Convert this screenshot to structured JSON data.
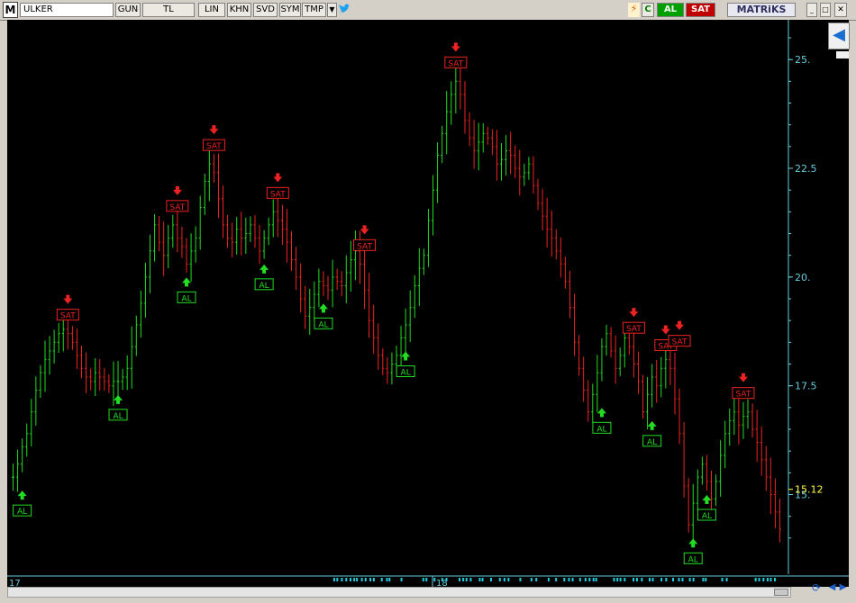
{
  "toolbar": {
    "logo": "M",
    "symbol": "ULKER",
    "period": "GUN",
    "currency": "TL",
    "scale": "LIN",
    "khn": "KHN",
    "svd": "SVD",
    "sym": "SYM",
    "tmp": "TMP",
    "dropdown": "▼",
    "twitter_icon": "twitter-icon",
    "flash_icon": "⚡",
    "refresh": "C",
    "buy_label": "AL",
    "sell_label": "SAT",
    "brand": "MATRiKS",
    "minimize": "_",
    "maximize": "□",
    "close": "✕"
  },
  "colors": {
    "background": "#000000",
    "up": "#22dd22",
    "down": "#ee2222",
    "axis": "#66ccdd",
    "last_price": "#ffff44",
    "buy": "#22dd22",
    "sell": "#ee2222"
  },
  "side_button_icon": "arrow-left-icon",
  "bottom_bar": {
    "month_left": "17",
    "month_mid": "18"
  },
  "chart_data": {
    "type": "line",
    "title": "",
    "xlabel": "",
    "ylabel": "",
    "ylim": [
      13.5,
      25.5
    ],
    "ytick_labels": [
      "25.",
      "22.5",
      "20.",
      "17.5",
      "15."
    ],
    "yticks": [
      25,
      22.5,
      20,
      17.5,
      15
    ],
    "last_price": 15.12,
    "last_price_label": "15.12",
    "x_labels": [
      "17",
      "18"
    ],
    "grid": false,
    "close": [
      15.4,
      15.7,
      16.1,
      16.4,
      16.9,
      17.4,
      17.8,
      18.1,
      18.3,
      18.5,
      18.7,
      18.8,
      18.7,
      18.5,
      18.2,
      17.9,
      17.7,
      17.6,
      17.8,
      17.7,
      17.6,
      17.5,
      17.6,
      17.6,
      17.7,
      17.9,
      18.4,
      18.9,
      19.4,
      20.0,
      20.6,
      21.2,
      20.8,
      20.5,
      20.9,
      21.2,
      20.9,
      20.7,
      20.3,
      20.6,
      20.9,
      21.6,
      22.2,
      22.6,
      22.4,
      21.8,
      21.2,
      20.9,
      20.8,
      21.1,
      20.9,
      21.0,
      21.2,
      20.9,
      20.6,
      20.9,
      21.2,
      21.5,
      21.3,
      21.1,
      20.8,
      20.4,
      20.0,
      19.5,
      19.1,
      19.3,
      19.6,
      19.9,
      19.8,
      19.7,
      20.0,
      19.9,
      19.8,
      20.1,
      20.4,
      20.6,
      20.3,
      19.7,
      19.0,
      18.6,
      18.2,
      17.9,
      17.8,
      18.0,
      18.2,
      18.6,
      18.9,
      19.3,
      19.8,
      20.2,
      20.5,
      21.3,
      22.0,
      22.8,
      23.3,
      23.8,
      24.2,
      24.5,
      24.2,
      23.6,
      23.2,
      22.9,
      23.1,
      23.3,
      23.2,
      23.0,
      22.6,
      22.7,
      22.9,
      22.8,
      22.5,
      22.3,
      22.4,
      22.6,
      22.1,
      21.7,
      21.4,
      21.1,
      20.9,
      20.6,
      20.3,
      19.9,
      19.3,
      18.5,
      17.9,
      17.4,
      16.9,
      17.3,
      17.8,
      18.4,
      18.7,
      18.3,
      17.9,
      18.2,
      18.6,
      18.4,
      18.0,
      17.6,
      16.9,
      17.3,
      17.7,
      17.5,
      17.9,
      18.1,
      17.9,
      17.2,
      16.4,
      15.2,
      14.3,
      14.8,
      15.4,
      15.7,
      15.3,
      14.9,
      15.3,
      15.9,
      16.4,
      16.7,
      16.9,
      16.6,
      16.8,
      16.9,
      16.5,
      16.2,
      15.8,
      15.4,
      15.0,
      14.6,
      14.2
    ],
    "signals": [
      {
        "label": "AL",
        "type": "buy",
        "index": 2,
        "price": 15.4
      },
      {
        "label": "SAT",
        "type": "sell",
        "index": 12,
        "price": 18.7
      },
      {
        "label": "AL",
        "type": "buy",
        "index": 23,
        "price": 17.6
      },
      {
        "label": "SAT",
        "type": "sell",
        "index": 36,
        "price": 21.2
      },
      {
        "label": "AL",
        "type": "buy",
        "index": 38,
        "price": 20.3
      },
      {
        "label": "SAT",
        "type": "sell",
        "index": 44,
        "price": 22.6
      },
      {
        "label": "AL",
        "type": "buy",
        "index": 55,
        "price": 20.6
      },
      {
        "label": "SAT",
        "type": "sell",
        "index": 58,
        "price": 21.5
      },
      {
        "label": "AL",
        "type": "buy",
        "index": 68,
        "price": 19.7
      },
      {
        "label": "SAT",
        "type": "sell",
        "index": 77,
        "price": 20.3
      },
      {
        "label": "AL",
        "type": "buy",
        "index": 86,
        "price": 18.6
      },
      {
        "label": "SAT",
        "type": "sell",
        "index": 97,
        "price": 24.5
      },
      {
        "label": "AL",
        "type": "buy",
        "index": 129,
        "price": 17.3
      },
      {
        "label": "SAT",
        "type": "sell",
        "index": 136,
        "price": 18.4
      },
      {
        "label": "AL",
        "type": "buy",
        "index": 140,
        "price": 17.0
      },
      {
        "label": "SAT",
        "type": "sell",
        "index": 143,
        "price": 18.0
      },
      {
        "label": "SAT",
        "type": "sell",
        "index": 146,
        "price": 18.1
      },
      {
        "label": "AL",
        "type": "buy",
        "index": 149,
        "price": 14.3
      },
      {
        "label": "AL",
        "type": "buy",
        "index": 152,
        "price": 15.3
      },
      {
        "label": "SAT",
        "type": "sell",
        "index": 160,
        "price": 16.9
      }
    ]
  }
}
